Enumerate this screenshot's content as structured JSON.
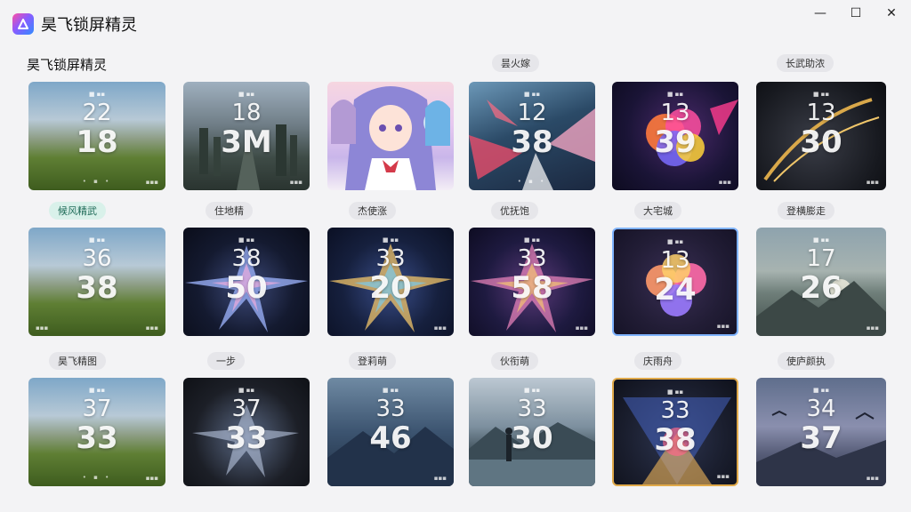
{
  "window": {
    "title": "昊飞锁屏精灵",
    "controls": {
      "minimize": "—",
      "maximize": "☐",
      "close": "✕"
    }
  },
  "section": {
    "title": "昊飞锁屏精灵"
  },
  "chips": {
    "row1": [
      "昙火嫁",
      "长武助浓"
    ],
    "row2": [
      "候风精武",
      "住地精",
      "杰使涨",
      "优抚饱",
      "大宅城",
      "登横膨走"
    ],
    "row3": [
      "昊飞精图",
      "一步",
      "登莉萌",
      "伙衔萌",
      "庆雨舟",
      "使庐颜执"
    ]
  },
  "cards": {
    "row1": [
      {
        "hh": "22",
        "mm": "18"
      },
      {
        "hh": "18",
        "mm": "3M"
      },
      {
        "hh": "",
        "mm": ""
      },
      {
        "hh": "12",
        "mm": "38"
      },
      {
        "hh": "13",
        "mm": "39"
      },
      {
        "hh": "13",
        "mm": "30"
      }
    ],
    "row2": [
      {
        "hh": "36",
        "mm": "38"
      },
      {
        "hh": "38",
        "mm": "50"
      },
      {
        "hh": "33",
        "mm": "20"
      },
      {
        "hh": "33",
        "mm": "58"
      },
      {
        "hh": "13",
        "mm": "24"
      },
      {
        "hh": "17",
        "mm": "26"
      }
    ],
    "row3": [
      {
        "hh": "37",
        "mm": "33"
      },
      {
        "hh": "37",
        "mm": "33"
      },
      {
        "hh": "33",
        "mm": "46"
      },
      {
        "hh": "33",
        "mm": "30"
      },
      {
        "hh": "33",
        "mm": "38"
      },
      {
        "hh": "34",
        "mm": "37"
      }
    ]
  },
  "card_glyphs": {
    "lock": "■ ▪▪",
    "dots": "• ▪ •",
    "corner": "▪▪▪"
  },
  "colors": {
    "active_chip": "#d9f1ea",
    "chip": "#e6e6ea",
    "background": "#f3f3f5"
  }
}
